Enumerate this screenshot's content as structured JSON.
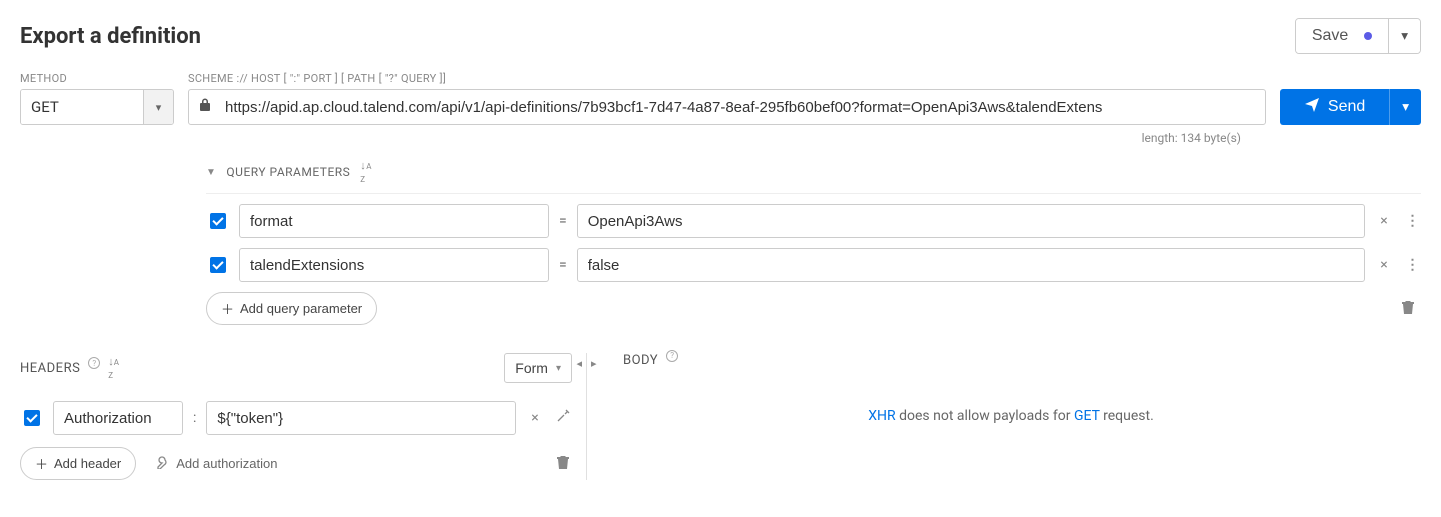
{
  "page": {
    "title": "Export a definition",
    "save_label": "Save"
  },
  "method": {
    "label": "METHOD",
    "value": "GET"
  },
  "url": {
    "label": "SCHEME :// HOST [ \":\" PORT ] [ PATH [ \"?\" QUERY ]]",
    "value": "https://apid.ap.cloud.talend.com/api/v1/api-definitions/7b93bcf1-7d47-4a87-8eaf-295fb60bef00?format=OpenApi3Aws&talendExtens",
    "length_info": "length: 134 byte(s)"
  },
  "send": {
    "label": "Send"
  },
  "query": {
    "header_label": "QUERY PARAMETERS",
    "add_label": "Add query parameter",
    "params": [
      {
        "key": "format",
        "value": "OpenApi3Aws"
      },
      {
        "key": "talendExtensions",
        "value": "false"
      }
    ]
  },
  "headers_section": {
    "label": "HEADERS",
    "view_mode": "Form",
    "add_label": "Add header",
    "add_auth_label": "Add authorization",
    "items": [
      {
        "key": "Authorization",
        "value": "${\"token\"}"
      }
    ]
  },
  "body_section": {
    "label": "BODY",
    "msg_prefix": "XHR",
    "msg_mid": " does not allow payloads for ",
    "msg_method": "GET",
    "msg_suffix": " request."
  }
}
